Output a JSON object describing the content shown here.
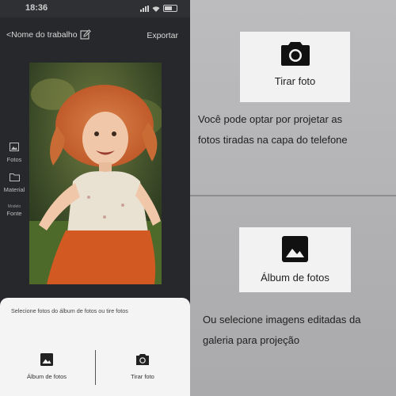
{
  "status_bar": {
    "time": "18:36"
  },
  "header": {
    "title": "<Nome do trabalho",
    "export_label": "Exportar"
  },
  "side_tools": [
    {
      "label": "Fotos",
      "icon": "image-icon"
    },
    {
      "label": "Material",
      "icon": "folder-icon"
    },
    {
      "sub_label": "Modelo",
      "label": "Fonte"
    }
  ],
  "bottom_sheet": {
    "hint": "Selecione fotos do álbum de fotos ou tire fotos",
    "album_label": "Álbum de fotos",
    "camera_label": "Tirar foto"
  },
  "explanation": {
    "camera_card_label": "Tirar foto",
    "camera_description_line1": "Você pode optar por projetar as",
    "camera_description_line2": "fotos tiradas na capa do telefone",
    "album_card_label": "Álbum de fotos",
    "album_description_line1": "Ou selecione imagens editadas da",
    "album_description_line2": "galeria para projeção"
  },
  "colors": {
    "phone_background": "#27282b",
    "sheet_background": "#f4f4f5",
    "panel_background": "#b9b9bb",
    "card_background": "#f2f2f3"
  }
}
